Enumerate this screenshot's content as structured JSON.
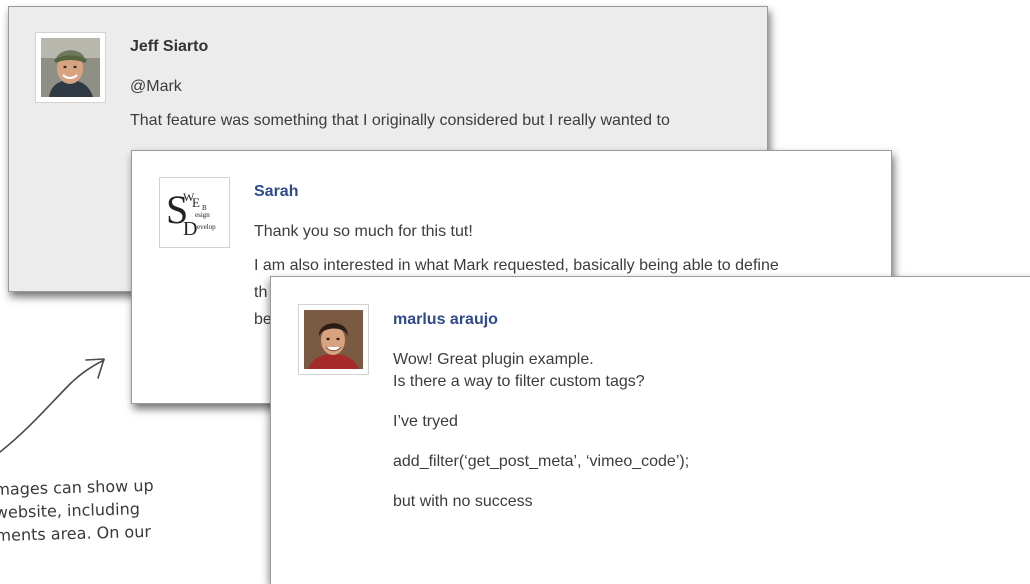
{
  "comments": [
    {
      "author": "Jeff Siarto",
      "reply_to": "@Mark",
      "paragraphs": [
        "That feature was something that I originally considered but I really wanted to"
      ],
      "avatar": "man-photo-avatar"
    },
    {
      "author": "Sarah",
      "paragraphs": [
        "Thank you so much for this tut!",
        "I am also interested in what Mark requested, basically being able to define",
        "th",
        "be"
      ],
      "avatar": "web-design-develop-logo-avatar",
      "logo_text": {
        "S": "S",
        "W": "W",
        "E": "E",
        "B": "B",
        "design": "esign",
        "D": "D",
        "develop": "evelop"
      }
    },
    {
      "author": "marlus araujo",
      "paragraphs": [
        "Wow! Great plugin example.",
        "Is there a way to filter custom tags?",
        "I’ve tryed",
        "add_filter(‘get_post_meta’, ‘vimeo_code’);",
        "but with no success"
      ],
      "avatar": "young-man-photo-avatar"
    }
  ],
  "annotation": {
    "lines": [
      "mages can show up",
      "website, including",
      "ments area. On our",
      "                  "
    ]
  },
  "colors": {
    "author_blue": "#2f4a8a",
    "card_gray": "#ececec",
    "text": "#3c3c3c"
  }
}
